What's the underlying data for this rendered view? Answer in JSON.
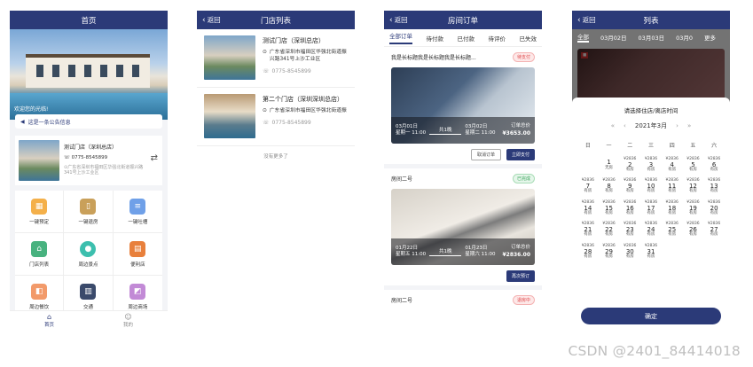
{
  "home": {
    "title": "首页",
    "hero_welcome": "欢迎您的光临!",
    "notice": "这是一条公告信息",
    "store": {
      "name": "测试门店（深圳总店）",
      "phone": "0775-8545899",
      "address": "广东省深圳市福田区华强北街道振兴路341号上沙工业区"
    },
    "grid": [
      {
        "label": "一键预定",
        "icon": "calendar-icon",
        "color": "#f4b04a"
      },
      {
        "label": "一键退房",
        "icon": "door-icon",
        "color": "#c9a05a"
      },
      {
        "label": "一键吐槽",
        "icon": "note-icon",
        "color": "#6fa0e8"
      },
      {
        "label": "门店列表",
        "icon": "store-icon",
        "color": "#48b27f"
      },
      {
        "label": "周边景点",
        "icon": "location-icon",
        "color": "#3cbfae"
      },
      {
        "label": "便利店",
        "icon": "shop-icon",
        "color": "#e8803c"
      },
      {
        "label": "周边餐饮",
        "icon": "food-icon",
        "color": "#f29a6a"
      },
      {
        "label": "交通",
        "icon": "transport-icon",
        "color": "#3a4a6b"
      },
      {
        "label": "周边商场",
        "icon": "mall-icon",
        "color": "#c28ad6"
      }
    ],
    "tabbar": [
      {
        "label": "首页",
        "icon": "home-icon"
      },
      {
        "label": "我的",
        "icon": "user-icon"
      }
    ]
  },
  "store_list": {
    "title": "门店列表",
    "back": "返回",
    "items": [
      {
        "name": "测试门店（深圳总店）",
        "address": "广东省深圳市福田区华强北街道振兴路341号上沙工业区",
        "phone": "0775-8545899"
      },
      {
        "name": "第二个门店（深圳深圳总店）",
        "address": "广东省深圳市福田区华强北街道振",
        "phone": "0775-8545899"
      }
    ],
    "no_more": "没有更多了"
  },
  "orders": {
    "title": "房间订单",
    "back": "返回",
    "tabs": [
      "全部订单",
      "待付款",
      "已付款",
      "待评价",
      "已失效"
    ],
    "list": [
      {
        "name": "我是长标题我是长标题我是长标题...",
        "status": "待支付",
        "status_color": "red",
        "checkin": "03月01日",
        "checkin_wk": "星期一 11:00",
        "nights": "共1晚",
        "checkout": "03月02日",
        "checkout_wk": "星期二 11:00",
        "total_label": "订单总价",
        "total": "¥3653.00",
        "buttons": [
          "取消订单",
          "立即支付"
        ]
      },
      {
        "name": "房间二号",
        "status": "已完成",
        "status_color": "green",
        "checkin": "01月22日",
        "checkin_wk": "星期五 11:00",
        "nights": "共1晚",
        "checkout": "01月23日",
        "checkout_wk": "星期六 11:00",
        "total_label": "订单总价",
        "total": "¥2836.00",
        "buttons": [
          "再次预订"
        ]
      },
      {
        "name": "房间二号",
        "status": "退房中",
        "status_color": "red"
      }
    ]
  },
  "calendar": {
    "title": "列表",
    "back": "返回",
    "tabs": [
      "全部",
      "03月02日",
      "03月03日",
      "03月0",
      "更多"
    ],
    "sheet_title": "请选择住店/离店时间",
    "month": "2021年3月",
    "weekdays": [
      "日",
      "一",
      "二",
      "三",
      "四",
      "五",
      "六"
    ],
    "days": [
      {
        "d": "1",
        "p": "",
        "s": "无房"
      },
      {
        "d": "2",
        "p": "¥2836",
        "s": "有房"
      },
      {
        "d": "3",
        "p": "¥2836",
        "s": "有房"
      },
      {
        "d": "4",
        "p": "¥2836",
        "s": "有房"
      },
      {
        "d": "5",
        "p": "¥2836",
        "s": "有房"
      },
      {
        "d": "6",
        "p": "¥2836",
        "s": "有房"
      },
      {
        "d": "7",
        "p": "¥2836",
        "s": "有房"
      },
      {
        "d": "8",
        "p": "¥2836",
        "s": "有房"
      },
      {
        "d": "9",
        "p": "¥2836",
        "s": "有房"
      },
      {
        "d": "10",
        "p": "¥2836",
        "s": "有房"
      },
      {
        "d": "11",
        "p": "¥2836",
        "s": "有房"
      },
      {
        "d": "12",
        "p": "¥2836",
        "s": "有房"
      },
      {
        "d": "13",
        "p": "¥2836",
        "s": "有房"
      },
      {
        "d": "14",
        "p": "¥2836",
        "s": "有房"
      },
      {
        "d": "15",
        "p": "¥2836",
        "s": "有房"
      },
      {
        "d": "16",
        "p": "¥2836",
        "s": "有房"
      },
      {
        "d": "17",
        "p": "¥2836",
        "s": "有房"
      },
      {
        "d": "18",
        "p": "¥2836",
        "s": "有房"
      },
      {
        "d": "19",
        "p": "¥2836",
        "s": "有房"
      },
      {
        "d": "20",
        "p": "¥2836",
        "s": "有房"
      },
      {
        "d": "21",
        "p": "¥2836",
        "s": "有房"
      },
      {
        "d": "22",
        "p": "¥2836",
        "s": "有房"
      },
      {
        "d": "23",
        "p": "¥2836",
        "s": "有房"
      },
      {
        "d": "24",
        "p": "¥2836",
        "s": "有房"
      },
      {
        "d": "25",
        "p": "¥2836",
        "s": "有房"
      },
      {
        "d": "26",
        "p": "¥2836",
        "s": "有房"
      },
      {
        "d": "27",
        "p": "¥2836",
        "s": "有房"
      },
      {
        "d": "28",
        "p": "¥2836",
        "s": "有房"
      },
      {
        "d": "29",
        "p": "¥2836",
        "s": "有房"
      },
      {
        "d": "30",
        "p": "¥2836",
        "s": "有房"
      },
      {
        "d": "31",
        "p": "¥2836",
        "s": "有房"
      }
    ],
    "confirm": "确定"
  },
  "watermark": "CSDN @2401_84414018"
}
